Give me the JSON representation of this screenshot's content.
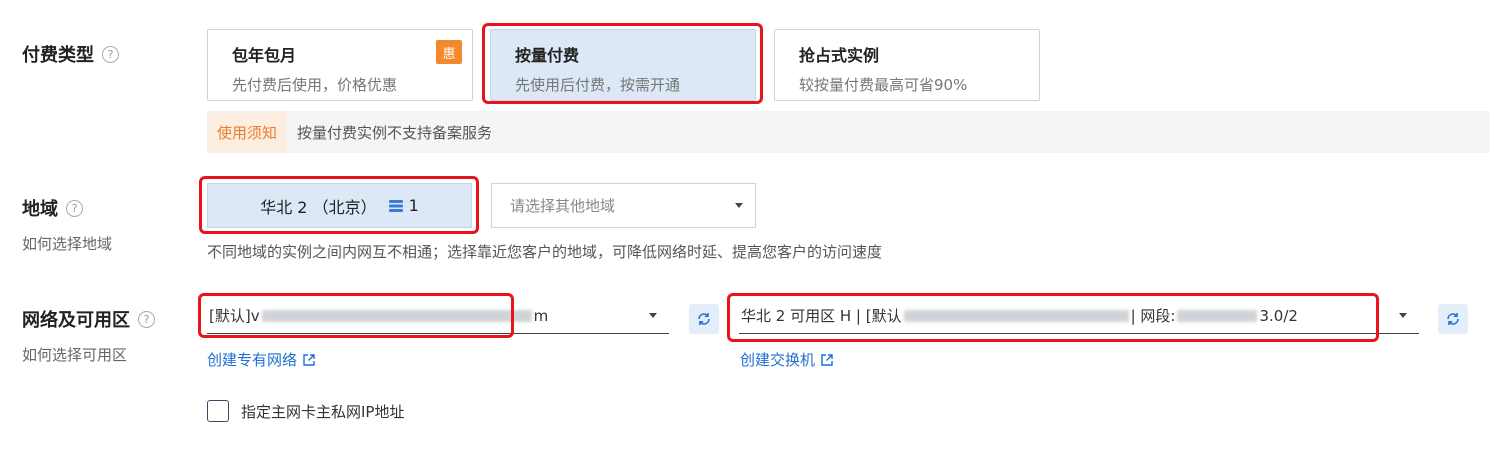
{
  "billing": {
    "label": "付费类型",
    "options": [
      {
        "title": "包年包月",
        "desc": "先付费后使用，价格优惠",
        "badge": "惠"
      },
      {
        "title": "按量付费",
        "desc": "先使用后付费，按需开通"
      },
      {
        "title": "抢占式实例",
        "desc": "较按量付费最高可省90%"
      }
    ],
    "notice_tag": "使用须知",
    "notice_text": "按量付费实例不支持备案服务"
  },
  "region": {
    "label": "地域",
    "sub": "如何选择地域",
    "selected_name": "华北 2 （北京）",
    "selected_count": "1",
    "other_placeholder": "请选择其他地域",
    "hint": "不同地域的实例之间内网互不相通；选择靠近您客户的地域，可降低网络时延、提高您客户的访问速度"
  },
  "network": {
    "label": "网络及可用区",
    "sub": "如何选择可用区",
    "vpc_prefix": "[默认]v",
    "vpc_suffix": "m",
    "vswitch_prefix": "华北 2 可用区 H | [默认",
    "vswitch_mid": "| 网段: ",
    "vswitch_suffix": "3.0/2",
    "create_vpc_link": "创建专有网络",
    "create_vswitch_link": "创建交换机",
    "checkbox_label": "指定主网卡主私网IP地址"
  },
  "help_glyph": "?",
  "colors": {
    "accent": "#1f6fd1",
    "selected_bg": "#dce8f5",
    "highlight": "#e8141b",
    "badge": "#f28a2b"
  }
}
